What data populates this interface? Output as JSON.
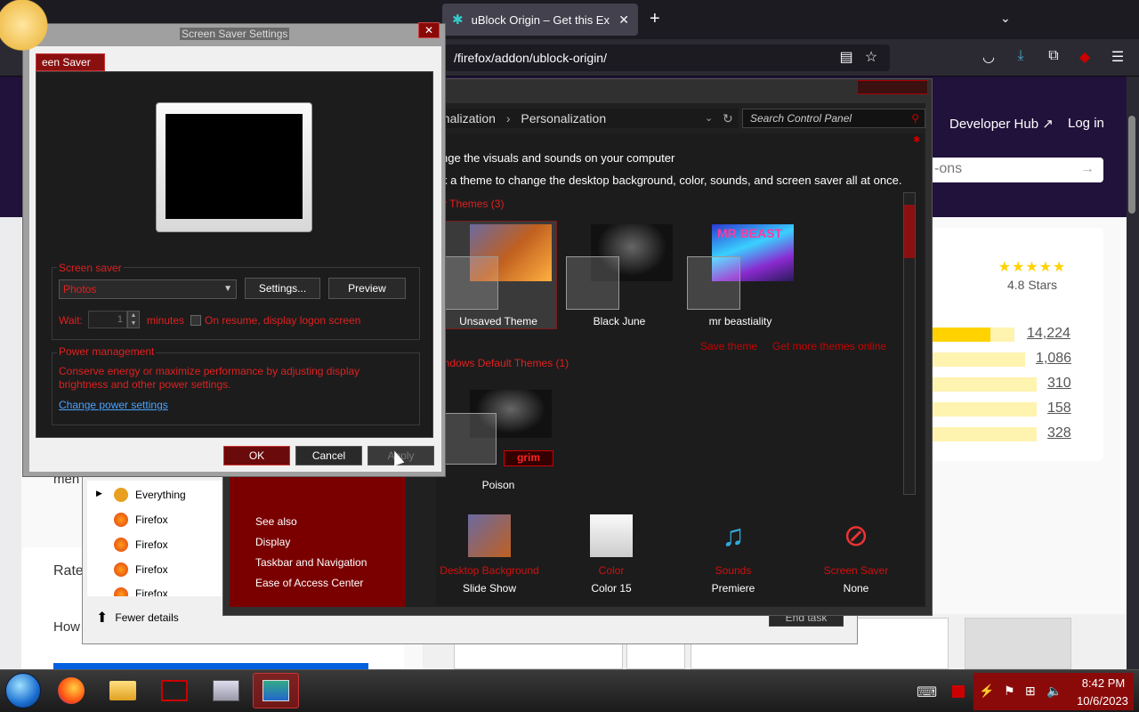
{
  "browser": {
    "active_tab_title": "uBlock Origin – Get this Extensi",
    "url": "/firefox/addon/ublock-origin/",
    "new_tab_glyph": "+",
    "icons": [
      "reader-view-icon",
      "bookmark-star-icon",
      "pocket-icon",
      "downloads-icon",
      "extensions-icon",
      "ublock-icon",
      "menu-icon"
    ]
  },
  "amo": {
    "developer_hub": "Developer Hub ↗",
    "login": "Log in",
    "search_placeholder": "-ons",
    "rating_stars": "★★★★★",
    "rating_text": "4.8 Stars",
    "rating_counts": [
      "14,224",
      "1,086",
      "310",
      "158",
      "328"
    ],
    "rating_fractions": [
      0.7,
      0.05,
      0.02,
      0.01,
      0.02
    ],
    "rate_label": "Rate",
    "how_label": "How",
    "men_label": "men"
  },
  "task_manager": {
    "items": [
      "Everything",
      "Firefox",
      "Firefox",
      "Firefox",
      "Firefox"
    ],
    "fewer_details": "Fewer details",
    "end_task": "End task"
  },
  "control_panel": {
    "breadcrumb_1": "onalization",
    "breadcrumb_2": "Personalization",
    "search_placeholder": "Search Control Panel",
    "heading": "nge the visuals and sounds on your computer",
    "subheading": "k a theme to change the desktop background, color, sounds, and screen saver all at once.",
    "my_themes": "y Themes (3)",
    "themes": [
      "Unsaved Theme",
      "Black June",
      "mr beastiality"
    ],
    "save_theme": "Save theme",
    "get_more": "Get more themes online",
    "default_themes": "indows Default Themes (1)",
    "default_theme": "Poison",
    "default_theme_badge": "grim",
    "thumbnail_text": "MR BEAST",
    "see_also": "See also",
    "sidebar_links": [
      "Display",
      "Taskbar and Navigation",
      "Ease of Access Center"
    ],
    "bottom": [
      {
        "label": "Desktop Background",
        "value": "Slide Show"
      },
      {
        "label": "Color",
        "value": "Color 15"
      },
      {
        "label": "Sounds",
        "value": "Premiere"
      },
      {
        "label": "Screen Saver",
        "value": "None"
      }
    ]
  },
  "screensaver": {
    "title": "Screen Saver Settings",
    "tab": "een Saver",
    "group_screen_saver": "Screen saver",
    "selected": "Photos",
    "settings_btn": "Settings...",
    "preview_btn": "Preview",
    "wait_label": "Wait:",
    "wait_value": "1",
    "minutes": "minutes",
    "resume_label": "On resume, display logon screen",
    "group_power": "Power management",
    "power_text": "Conserve energy or maximize performance by adjusting display brightness and other power settings.",
    "power_link": "Change power settings",
    "ok": "OK",
    "cancel": "Cancel",
    "apply": "Apply"
  },
  "taskbar": {
    "time": "8:42 PM",
    "date": "10/6/2023"
  }
}
